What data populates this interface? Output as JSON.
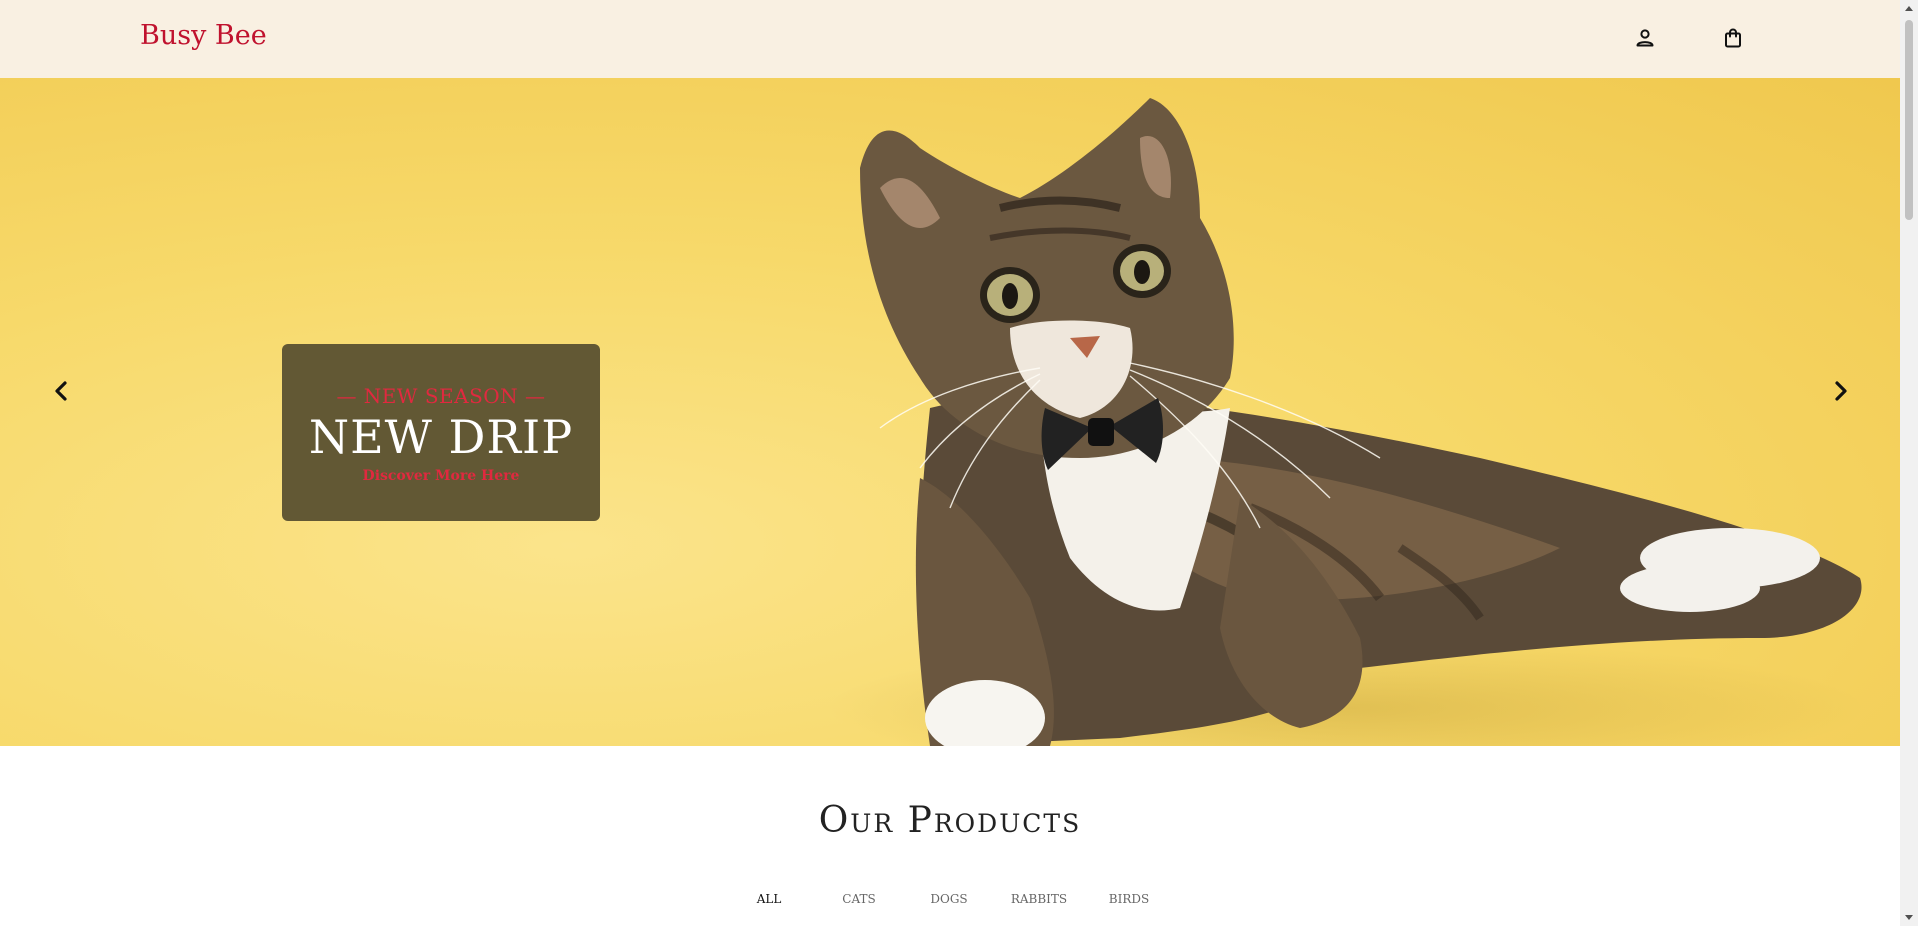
{
  "header": {
    "brand": "Busy Bee",
    "account_icon": "person-icon",
    "cart_icon": "shopping-bag-icon"
  },
  "hero": {
    "kicker": "— NEW SEASON —",
    "title": "NEW DRIP",
    "link": "Discover More Here",
    "prev_icon": "chevron-left-icon",
    "next_icon": "chevron-right-icon",
    "background_color": "#f7d96a",
    "promo_color": "#625834",
    "accent_color": "#e0293f"
  },
  "products": {
    "title": "Our Products",
    "tabs": [
      {
        "label": "ALL"
      },
      {
        "label": "CATS"
      },
      {
        "label": "DOGS"
      },
      {
        "label": "RABBITS"
      },
      {
        "label": "BIRDS"
      }
    ],
    "active_tab": "ALL"
  },
  "colors": {
    "brand": "#c0122e",
    "header_bg": "#f9f0e2"
  }
}
